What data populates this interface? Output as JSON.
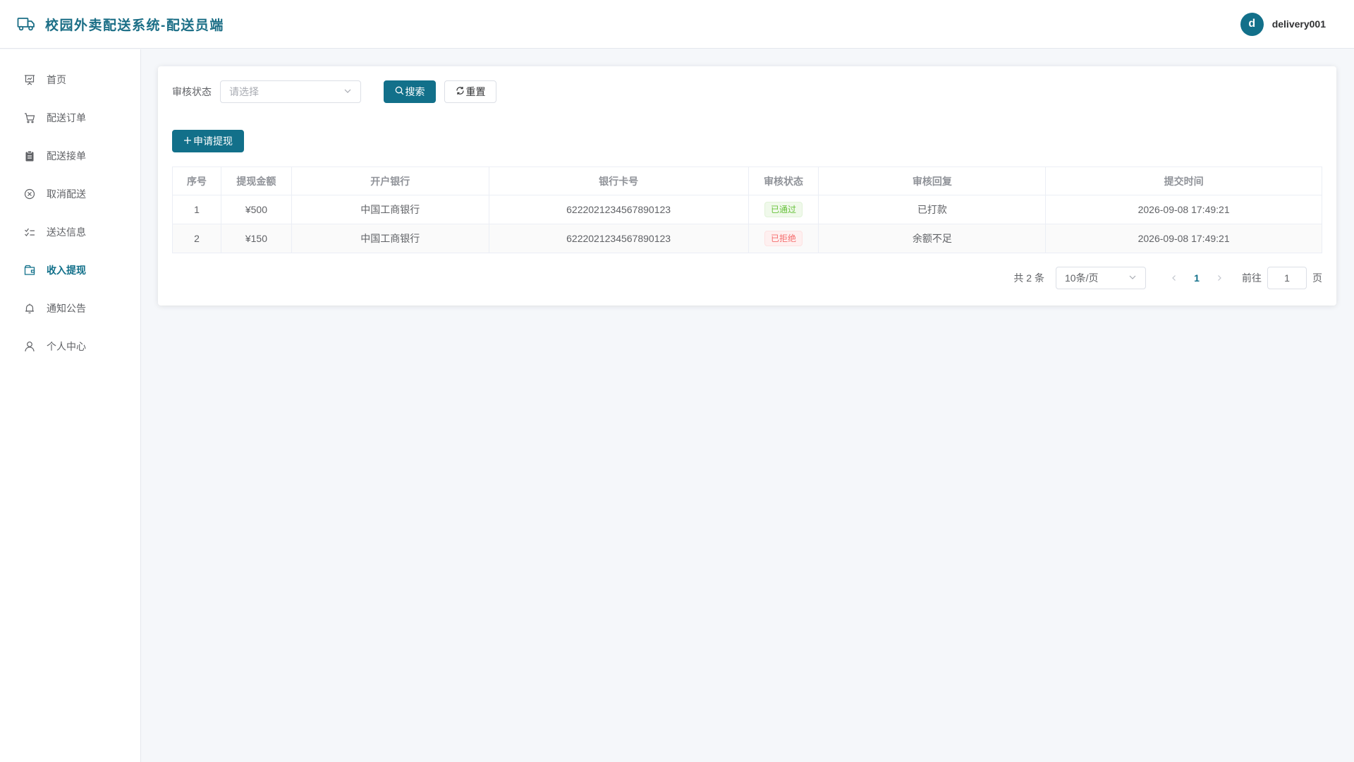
{
  "header": {
    "title": "校园外卖配送系统-配送员端",
    "brand_icon": "truck-icon",
    "user_initial": "d",
    "username": "delivery001"
  },
  "colors": {
    "accent": "#12708a",
    "success": "#67c23a",
    "danger": "#f56c6c"
  },
  "sidebar": {
    "items": [
      {
        "label": "首页",
        "icon": "presentation-icon"
      },
      {
        "label": "配送订单",
        "icon": "cart-icon"
      },
      {
        "label": "配送接单",
        "icon": "clipboard-icon"
      },
      {
        "label": "取消配送",
        "icon": "circle-close-icon"
      },
      {
        "label": "送达信息",
        "icon": "checklist-icon"
      },
      {
        "label": "收入提现",
        "icon": "wallet-icon",
        "active": true
      },
      {
        "label": "通知公告",
        "icon": "bell-icon"
      },
      {
        "label": "个人中心",
        "icon": "user-icon"
      }
    ]
  },
  "filter": {
    "status_label": "审核状态",
    "status_placeholder": "请选择",
    "search_label": "搜索",
    "reset_label": "重置"
  },
  "actions": {
    "apply_label": "申请提现"
  },
  "table": {
    "columns": [
      "序号",
      "提现金额",
      "开户银行",
      "银行卡号",
      "审核状态",
      "审核回复",
      "提交时间"
    ],
    "rows": [
      {
        "index": "1",
        "amount": "¥500",
        "bank": "中国工商银行",
        "card": "6222021234567890123",
        "status": "已通过",
        "status_type": "success",
        "reply": "已打款",
        "time": "2026-09-08 17:49:21"
      },
      {
        "index": "2",
        "amount": "¥150",
        "bank": "中国工商银行",
        "card": "6222021234567890123",
        "status": "已拒绝",
        "status_type": "danger",
        "reply": "余额不足",
        "time": "2026-09-08 17:49:21"
      }
    ]
  },
  "pagination": {
    "total_text": "共 2 条",
    "page_size": "10条/页",
    "current_page": "1",
    "goto_label": "前往",
    "goto_value": "1",
    "page_unit": "页"
  }
}
